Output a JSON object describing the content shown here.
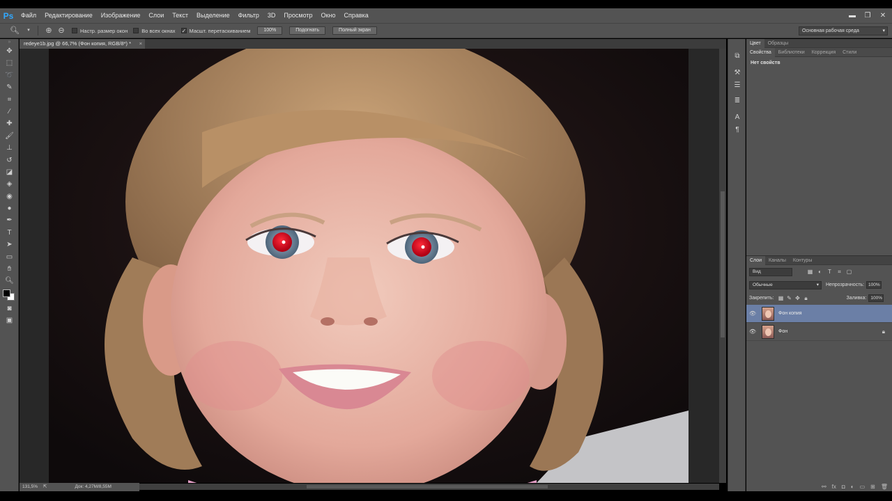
{
  "app": {
    "logo": "Ps"
  },
  "menu": [
    "Файл",
    "Редактирование",
    "Изображение",
    "Слои",
    "Текст",
    "Выделение",
    "Фильтр",
    "3D",
    "Просмотр",
    "Окно",
    "Справка"
  ],
  "window_controls": {
    "minimize": "▬",
    "restore": "❐",
    "close": "✕"
  },
  "options": {
    "tool_icon": "zoom-tool-icon",
    "resize_windows": "Настр. размер окон",
    "all_windows": "Во всех окнах",
    "scrubby_zoom": "Масшт. перетаскиванием",
    "scrubby_checked": "✓",
    "btn_100": "100%",
    "btn_fit": "Подогнать",
    "btn_full": "Полный экран",
    "workspace": "Основная рабочая среда"
  },
  "document": {
    "tab_title": "redeye1b.jpg @ 66,7% (Фон копия, RGB/8*) *",
    "close": "×",
    "zoom": "131,5%",
    "doc_info": "Док: 4,27M/8,55M"
  },
  "panels": {
    "top_tabs": [
      "Цвет",
      "Образцы"
    ],
    "mid_tabs": [
      "Свойства",
      "Библиотеки",
      "Коррекция",
      "Стили"
    ],
    "properties_text": "Нет свойств",
    "layer_tabs": [
      "Слои",
      "Каналы",
      "Контуры"
    ],
    "kind_filter": "Вид",
    "blend_mode": "Обычные",
    "opacity_label": "Непрозрачность:",
    "opacity_value": "100%",
    "lock_label": "Закрепить:",
    "fill_label": "Заливка:",
    "fill_value": "100%"
  },
  "layers": [
    {
      "name": "Фон копия",
      "selected": true
    },
    {
      "name": "Фон",
      "locked": true
    }
  ],
  "colors": {
    "accent": "#31a8ff",
    "selected_layer": "#6b7fa6",
    "panel": "#535353",
    "red_eye": "#d4001a"
  }
}
